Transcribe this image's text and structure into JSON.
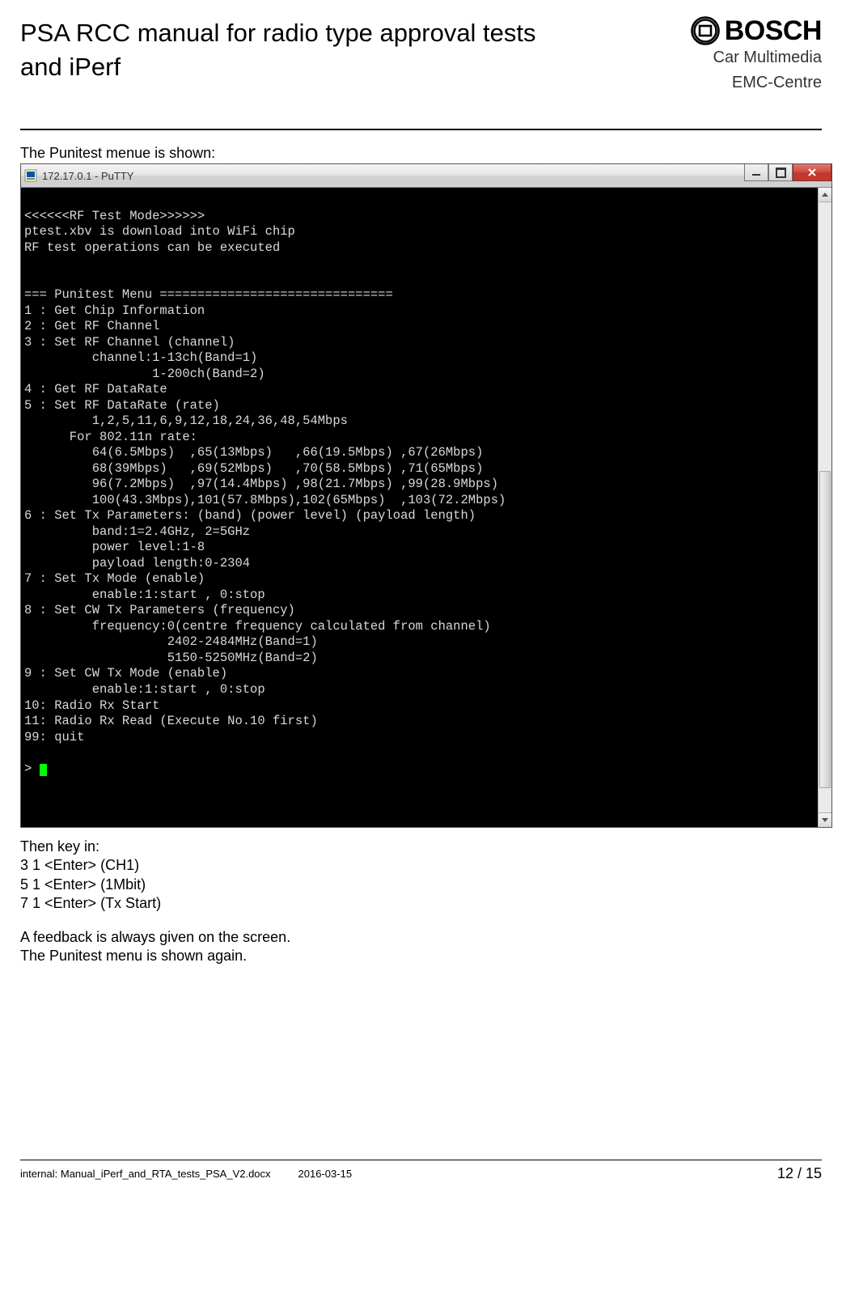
{
  "header": {
    "title": "PSA RCC manual for radio type approval tests and iPerf",
    "brand_word": "BOSCH",
    "brand_sub1": "Car Multimedia",
    "brand_sub2": "EMC-Centre"
  },
  "intro_line": "The Punitest menue is shown:",
  "putty": {
    "title": "172.17.0.1 - PuTTY",
    "terminal_lines": [
      "",
      "<<<<<<RF Test Mode>>>>>>",
      "ptest.xbv is download into WiFi chip",
      "RF test operations can be executed",
      "",
      "",
      "=== Punitest Menu ===============================",
      "1 : Get Chip Information",
      "2 : Get RF Channel",
      "3 : Set RF Channel (channel)",
      "         channel:1-13ch(Band=1)",
      "                 1-200ch(Band=2)",
      "4 : Get RF DataRate",
      "5 : Set RF DataRate (rate)",
      "         1,2,5,11,6,9,12,18,24,36,48,54Mbps",
      "      For 802.11n rate:",
      "         64(6.5Mbps)  ,65(13Mbps)   ,66(19.5Mbps) ,67(26Mbps)",
      "         68(39Mbps)   ,69(52Mbps)   ,70(58.5Mbps) ,71(65Mbps)",
      "         96(7.2Mbps)  ,97(14.4Mbps) ,98(21.7Mbps) ,99(28.9Mbps)",
      "         100(43.3Mbps),101(57.8Mbps),102(65Mbps)  ,103(72.2Mbps)",
      "6 : Set Tx Parameters: (band) (power level) (payload length)",
      "         band:1=2.4GHz, 2=5GHz",
      "         power level:1-8",
      "         payload length:0-2304",
      "7 : Set Tx Mode (enable)",
      "         enable:1:start , 0:stop",
      "8 : Set CW Tx Parameters (frequency)",
      "         frequency:0(centre frequency calculated from channel)",
      "                   2402-2484MHz(Band=1)",
      "                   5150-5250MHz(Band=2)",
      "9 : Set CW Tx Mode (enable)",
      "         enable:1:start , 0:stop",
      "10: Radio Rx Start",
      "11: Radio Rx Read (Execute No.10 first)",
      "99: quit",
      ""
    ],
    "prompt": "> "
  },
  "after": {
    "l1": "Then key in:",
    "l2": "3 1 <Enter> (CH1)",
    "l3": "5 1 <Enter> (1Mbit)",
    "l4": "7 1 <Enter> (Tx Start)",
    "l5": "A feedback is always given on the screen.",
    "l6": "The Punitest menu is shown again."
  },
  "footer": {
    "internal": "internal: Manual_iPerf_and_RTA_tests_PSA_V2.docx",
    "date": "2016-03-15",
    "page": "12 / 15"
  }
}
